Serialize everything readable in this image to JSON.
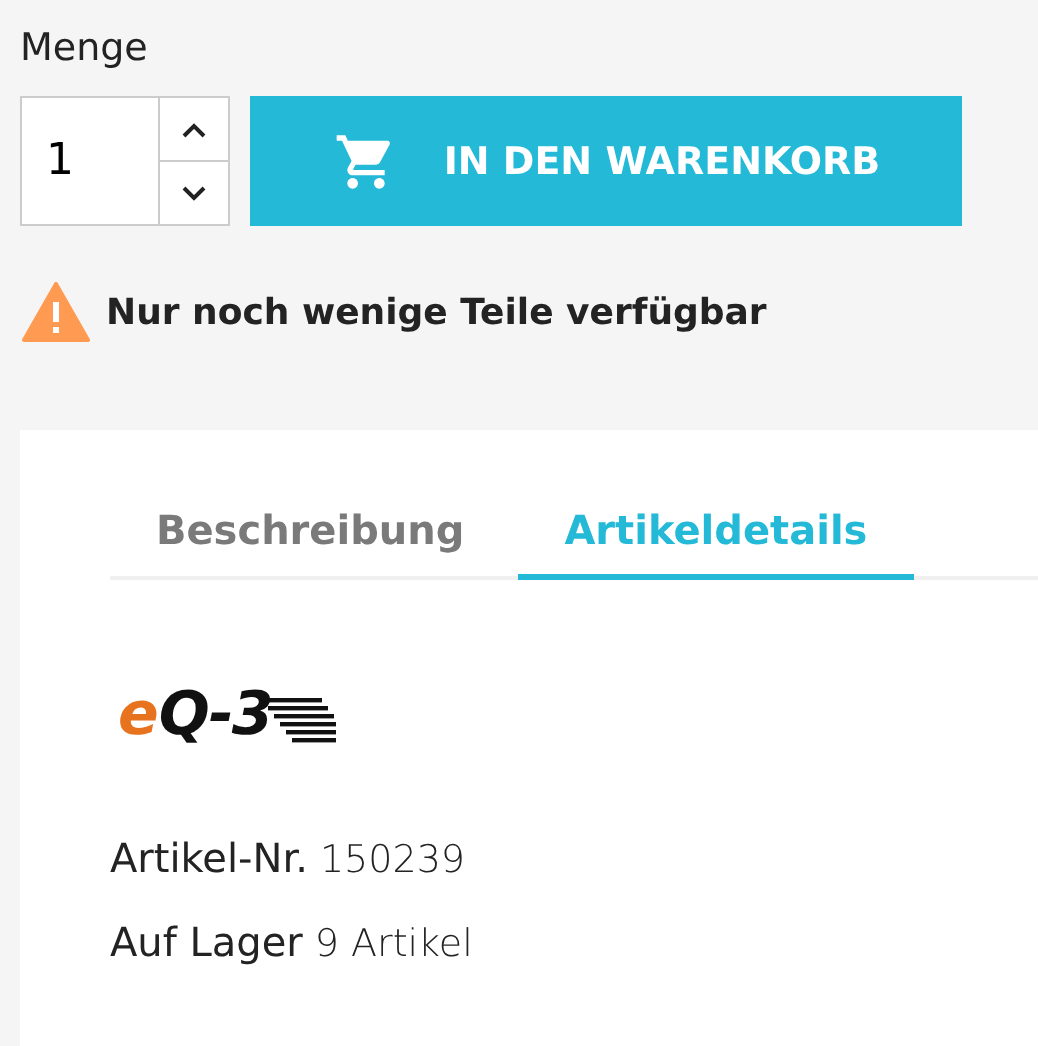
{
  "quantity": {
    "label": "Menge",
    "value": "1"
  },
  "cart_button": {
    "label": "IN DEN WARENKORB"
  },
  "stock_warning": {
    "text": "Nur noch wenige Teile verfügbar"
  },
  "tabs": [
    {
      "label": "Beschreibung",
      "selected": false
    },
    {
      "label": "Artikeldetails",
      "selected": true
    }
  ],
  "brand_logo": {
    "first": "e",
    "rest": "Q-3"
  },
  "details": [
    {
      "label": "Artikel-Nr.",
      "value": "150239"
    },
    {
      "label": "Auf Lager",
      "value": "9 Artikel"
    }
  ]
}
